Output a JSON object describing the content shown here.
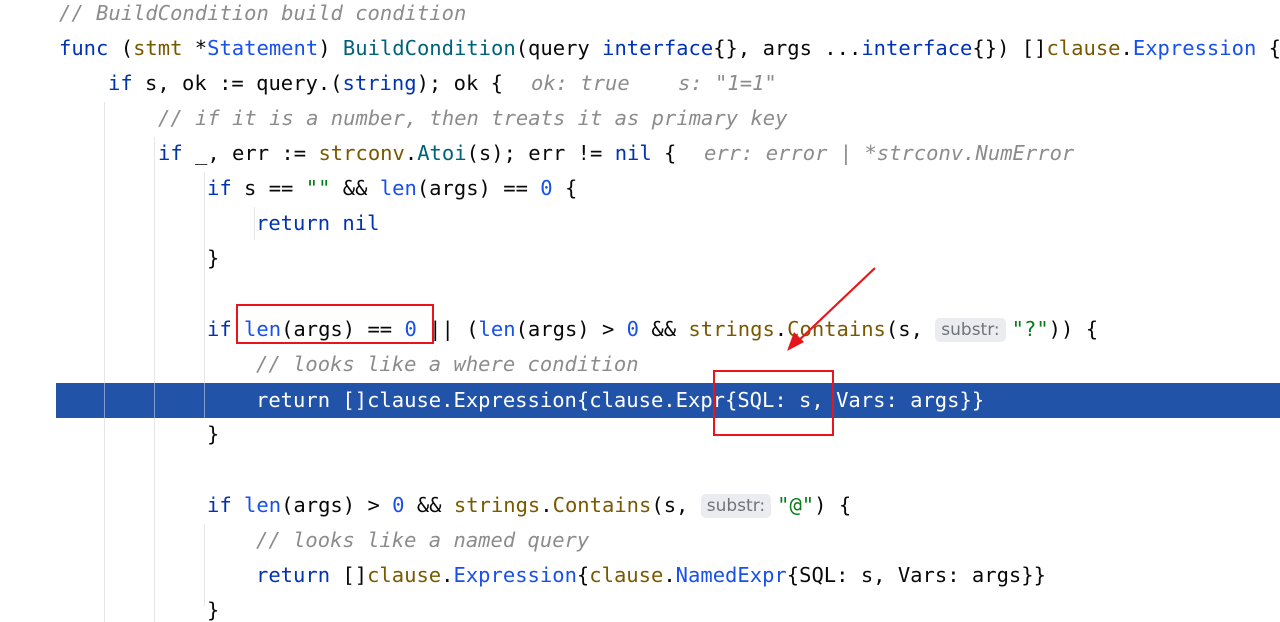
{
  "code": {
    "l1_comment": "// BuildCondition build condition",
    "l2": {
      "func": "func",
      "open": " (",
      "recv": "stmt",
      "star": " *",
      "recv_type": "Statement",
      "close": ") ",
      "name": "BuildCondition",
      "p1": "(query ",
      "iface1": "interface",
      "p2": "{}, args ...",
      "iface2": "interface",
      "p3": "{}) []",
      "pkg": "clause",
      "dot": ".",
      "ret": "Expression",
      "brace": " {"
    },
    "l3": {
      "if": "if",
      "t1": " s, ok := query.(",
      "string": "string",
      "t2": "); ok {",
      "hint1": "ok: true",
      "hint2": "s: \"1=1\""
    },
    "l4_comment": "// if it is a number, then treats it as primary key",
    "l5": {
      "if": "if",
      "t1": " _, err := ",
      "pkg": "strconv",
      "dot": ".",
      "fn": "Atoi",
      "t2": "(s); err != ",
      "nil": "nil",
      "t3": " {",
      "hint": "err: error | *strconv.NumError"
    },
    "l6": {
      "if": "if",
      "t1": " s == ",
      "str": "\"\"",
      "t2": " && ",
      "len": "len",
      "t3": "(args) == ",
      "num": "0",
      "t4": " {"
    },
    "l7": {
      "return": "return",
      "nil": " nil"
    },
    "l8_brace": "}",
    "l10": {
      "if": "if",
      "sp": " ",
      "len1": "len",
      "t1": "(args) == ",
      "num0": "0",
      "t2": " || (",
      "len2": "len",
      "t3": "(args) > ",
      "num1": "0",
      "t4": " && ",
      "pkg": "strings",
      "dot": ".",
      "fn": "Contains",
      "t5": "(s, ",
      "inlay": "substr:",
      "str": "\"?\"",
      "t6": ")) {"
    },
    "l11_comment": "// looks like a where condition",
    "l12": "return []clause.Expression{clause.Expr{SQL: s, Vars: args}}",
    "l13_brace": "}",
    "l15": {
      "if": "if",
      "sp": " ",
      "len": "len",
      "t1": "(args) > ",
      "num": "0",
      "t2": " && ",
      "pkg": "strings",
      "dot": ".",
      "fn": "Contains",
      "t3": "(s, ",
      "inlay": "substr:",
      "str": "\"@\"",
      "t4": ") {"
    },
    "l16_comment": "// looks like a named query",
    "l17": {
      "return": "return",
      "t1": " []",
      "pkg1": "clause",
      "dot1": ".",
      "ex1": "Expression",
      "t2": "{",
      "pkg2": "clause",
      "dot2": ".",
      "ex2": "NamedExpr",
      "t3": "{SQL: s, Vars: args}}"
    },
    "l18_brace": "}"
  },
  "colors": {
    "keyword": "#0033b3",
    "type": "#7a5800",
    "number": "#1750eb",
    "string": "#067d17",
    "comment": "#8c8c8c",
    "execution_line": "#2154a8",
    "annotation_red": "#e8161b"
  }
}
